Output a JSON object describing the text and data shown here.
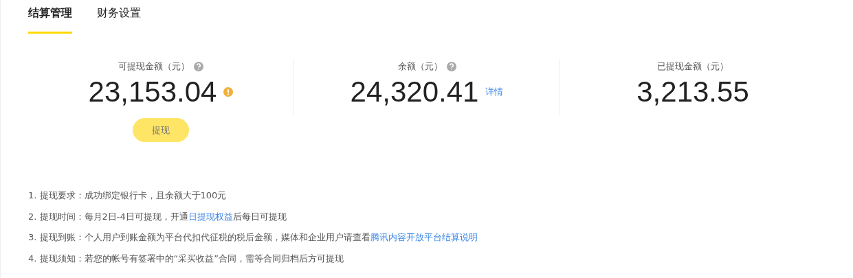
{
  "tabs": [
    {
      "label": "结算管理",
      "selected": true
    },
    {
      "label": "财务设置",
      "selected": false
    }
  ],
  "stats": [
    {
      "label": "可提现金额（元）",
      "help": true,
      "value": "23,153.04",
      "warning": true,
      "button": "提现"
    },
    {
      "label": "余额（元）",
      "help": true,
      "value": "24,320.41",
      "warning": false,
      "link": "详情"
    },
    {
      "label": "已提现金额（元）",
      "help": false,
      "value": "3,213.55",
      "warning": false
    }
  ],
  "notes": [
    {
      "parts": [
        {
          "kind": "text",
          "text": "1. 提现要求：成功绑定银行卡，且余额大于100元"
        }
      ]
    },
    {
      "parts": [
        {
          "kind": "text",
          "text": "2. 提现时间：每月2日-4日可提现，开通"
        },
        {
          "kind": "link",
          "text": "日提现权益"
        },
        {
          "kind": "text",
          "text": "后每日可提现"
        }
      ]
    },
    {
      "parts": [
        {
          "kind": "text",
          "text": "3. 提现到账：个人用户到账金额为平台代扣代征税的税后金额，媒体和企业用户请查看"
        },
        {
          "kind": "link",
          "text": "腾讯内容开放平台结算说明"
        }
      ]
    },
    {
      "parts": [
        {
          "kind": "text",
          "text": "4. 提现须知：若您的帐号有签署中的“采买收益”合同，需等合同归档后方可提现"
        }
      ]
    }
  ]
}
